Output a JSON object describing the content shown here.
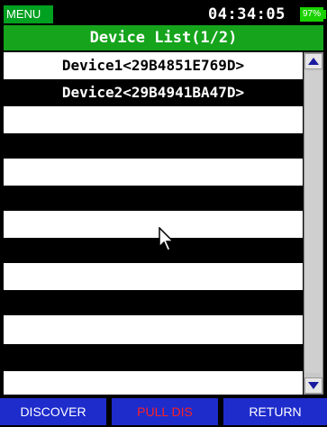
{
  "status": {
    "menu_label": "MENU",
    "time": "04:34:05",
    "battery": "97%"
  },
  "title": "Device List(1/2)",
  "devices": [
    {
      "label": "Device1<29B4851E769D>"
    },
    {
      "label": "Device2<29B4941BA47D>"
    }
  ],
  "empty_rows": 10,
  "buttons": {
    "discover": "DISCOVER",
    "pull_dis": "PULL DIS",
    "return": "RETURN"
  },
  "colors": {
    "title_bg": "#15a41c",
    "button_bg": "#1e2ccc",
    "pull_dis_text": "#ff2020",
    "battery_bg": "#19d200"
  },
  "icons": {
    "scroll_up": "triangle-up",
    "scroll_down": "triangle-down",
    "cursor": "mouse-pointer"
  }
}
